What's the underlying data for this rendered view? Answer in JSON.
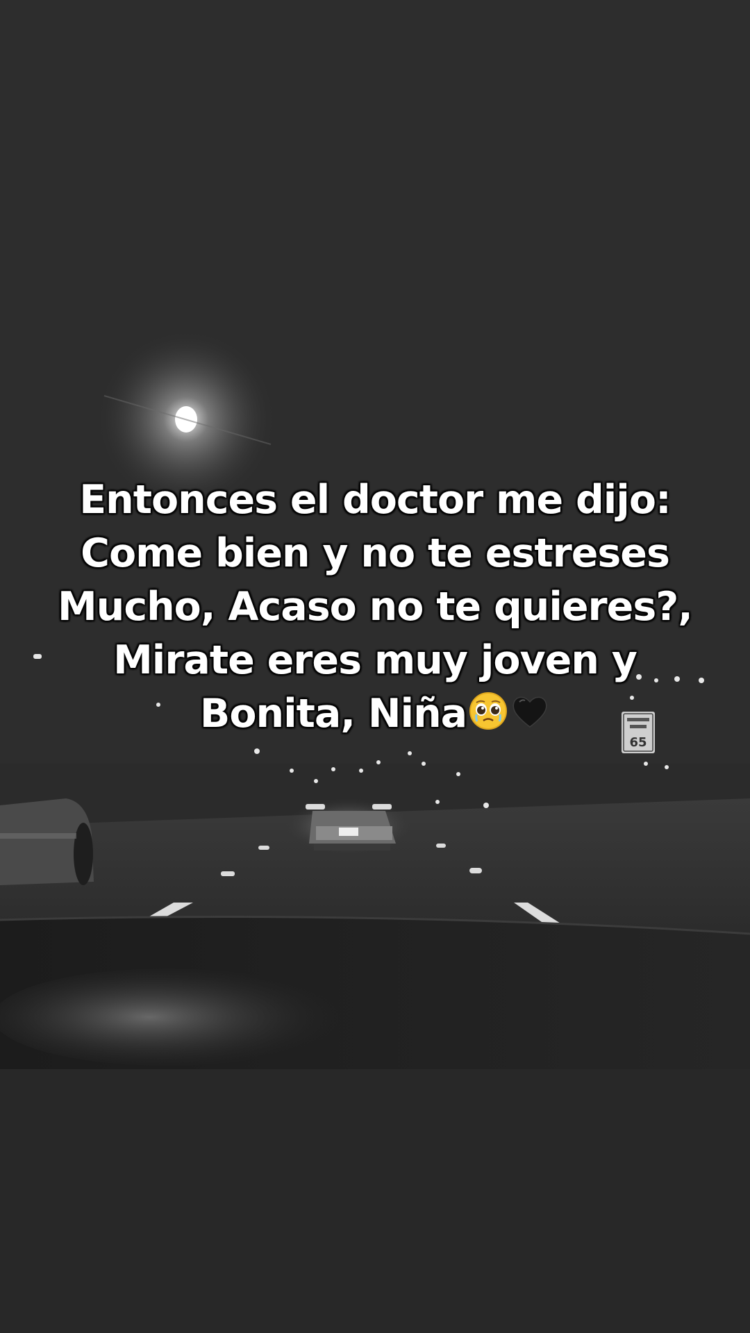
{
  "caption": {
    "lines": [
      "Entonces el doctor me dijo:",
      "Come bien y no te estreses",
      "Mucho, Acaso no te quieres?,",
      "Mirate eres muy joven y",
      "Bonita, Niña"
    ],
    "emojis": [
      "pleading-face-icon",
      "black-heart-icon"
    ]
  },
  "road_sign": {
    "text": "65"
  },
  "colors": {
    "background": "#2b2b2b",
    "caption_text": "#ffffff",
    "caption_outline": "#000000"
  }
}
